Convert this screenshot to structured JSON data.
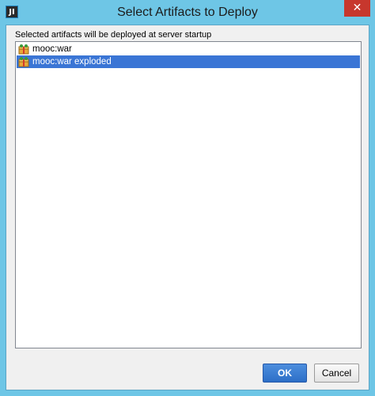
{
  "window": {
    "title": "Select Artifacts to Deploy",
    "app_icon_text": "JI",
    "close_symbol": "✕"
  },
  "dialog": {
    "caption": "Selected artifacts will be deployed at server startup",
    "artifacts": [
      {
        "label": "mooc:war",
        "icon": "artifact-icon",
        "selected": false
      },
      {
        "label": "mooc:war exploded",
        "icon": "artifact-icon",
        "selected": true
      }
    ]
  },
  "buttons": {
    "ok_label": "OK",
    "cancel_label": "Cancel"
  },
  "colors": {
    "titlebar": "#6ec6e6",
    "selection": "#3a75d5",
    "close": "#c7372d",
    "ok_button": "#2d6fc7"
  }
}
